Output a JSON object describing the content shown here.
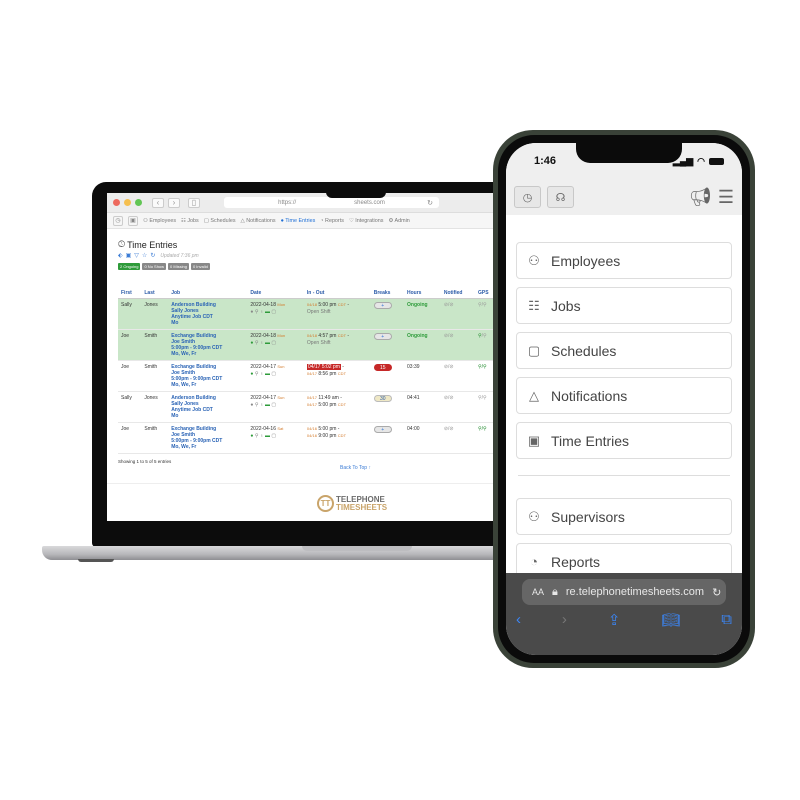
{
  "laptop": {
    "browser": {
      "url": "https://",
      "url_tail": "sheets.com",
      "traffic_lights": {
        "close": "#ed6a5e",
        "minimize": "#f5bf4f",
        "maximize": "#61c554"
      }
    },
    "app_nav": {
      "items": [
        {
          "icon": "person-icon",
          "label": "Employees"
        },
        {
          "icon": "jobs-icon",
          "label": "Jobs"
        },
        {
          "icon": "calendar-icon",
          "label": "Schedules"
        },
        {
          "icon": "bell-icon",
          "label": "Notifications"
        },
        {
          "icon": "clock-icon",
          "label": "Time Entries",
          "active": true
        },
        {
          "icon": "reports-icon",
          "label": "Reports"
        },
        {
          "icon": "integrations-icon",
          "label": "Integrations"
        },
        {
          "icon": "gear-icon",
          "label": "Admin"
        }
      ]
    },
    "page": {
      "title": "Time Entries",
      "updated": "Updated 7:36 pm",
      "badges": [
        {
          "label": "2 Ongoing",
          "color": "#2e9b3a"
        },
        {
          "label": "0 No Show",
          "color": "#888888"
        },
        {
          "label": "0 Missing",
          "color": "#888888"
        },
        {
          "label": "0 Invalid",
          "color": "#888888"
        }
      ]
    },
    "table": {
      "columns": [
        "First",
        "Last",
        "Job",
        "Date",
        "In - Out",
        "Breaks",
        "Hours",
        "Notified",
        "GPS"
      ],
      "rows": [
        {
          "first": "Sally",
          "last": "Jones",
          "job": [
            "Anderson Building",
            "Sally Jones",
            "Anytime Job CDT",
            "Mo"
          ],
          "date": "2022-04-18",
          "day": "Mon",
          "in_date": "04/18",
          "in_time": "5:00 pm",
          "in_tz": "CDT",
          "out": "Open Shift",
          "breaks": "+",
          "hours": "Ongoing",
          "ongoing": true
        },
        {
          "first": "Joe",
          "last": "Smith",
          "job": [
            "Exchange Building",
            "Joe Smith",
            "5:00pm - 9:00pm CDT",
            "Mo, We, Fr"
          ],
          "date": "2022-04-18",
          "day": "Mon",
          "in_date": "04/18",
          "in_time": "4:57 pm",
          "in_tz": "CDT",
          "out": "Open Shift",
          "breaks": "+",
          "hours": "Ongoing",
          "ongoing": true
        },
        {
          "first": "Joe",
          "last": "Smith",
          "job": [
            "Exchange Building",
            "Joe Smith",
            "5:00pm - 9:00pm CDT",
            "Mo, We, Fr"
          ],
          "date": "2022-04-17",
          "day": "Sun",
          "in_date": "04/17",
          "in_time": "5:02 pm",
          "out_date": "04/17",
          "out_time": "8:56 pm",
          "out_tz": "CDT",
          "breaks": "15",
          "hours": "03:39"
        },
        {
          "first": "Sally",
          "last": "Jones",
          "job": [
            "Anderson Building",
            "Sally Jones",
            "Anytime Job CDT",
            "Mo"
          ],
          "date": "2022-04-17",
          "day": "Sun",
          "in_date": "04/17",
          "in_time": "11:49 am",
          "out_date": "04/17",
          "out_time": "5:00 pm",
          "out_tz": "CDT",
          "breaks": "30",
          "hours": "04:41"
        },
        {
          "first": "Joe",
          "last": "Smith",
          "job": [
            "Exchange Building",
            "Joe Smith",
            "5:00pm - 9:00pm CDT",
            "Mo, We, Fr"
          ],
          "date": "2022-04-16",
          "day": "Sat",
          "in_date": "04/16",
          "in_time": "5:00 pm",
          "out_date": "04/16",
          "out_time": "9:00 pm",
          "out_tz": "CDT",
          "breaks": "+",
          "hours": "04:00"
        }
      ]
    },
    "showing": "Showing 1 to 5 of 5 entries",
    "back_to_top": "Back To Top ↑",
    "logo": {
      "line1": "TELEPHONE",
      "line2": "TIMESHEETS"
    }
  },
  "phone": {
    "time": "1:46",
    "menu": [
      {
        "icon": "person-icon",
        "label": "Employees"
      },
      {
        "icon": "jobs-icon",
        "label": "Jobs"
      },
      {
        "icon": "calendar-icon",
        "label": "Schedules"
      },
      {
        "icon": "bell-icon",
        "label": "Notifications"
      },
      {
        "icon": "time-entries-icon",
        "label": "Time Entries"
      }
    ],
    "menu2": [
      {
        "icon": "person-icon",
        "label": "Supervisors"
      },
      {
        "icon": "pie-chart-icon",
        "label": "Reports"
      }
    ],
    "safari": {
      "aa": "AA",
      "url": "re.telephonetimesheets.com"
    }
  }
}
